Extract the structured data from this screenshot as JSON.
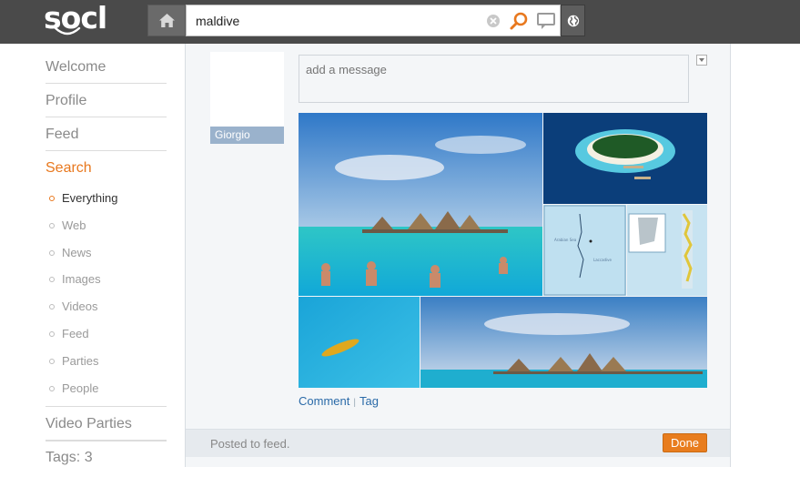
{
  "app": {
    "logo_text": "socl"
  },
  "search": {
    "value": "maldive",
    "placeholder": ""
  },
  "sidebar": {
    "nav": [
      {
        "label": "Welcome"
      },
      {
        "label": "Profile"
      },
      {
        "label": "Feed"
      },
      {
        "label": "Search"
      }
    ],
    "search_sub_items": [
      {
        "label": "Everything",
        "active": true
      },
      {
        "label": "Web"
      },
      {
        "label": "News"
      },
      {
        "label": "Images"
      },
      {
        "label": "Videos"
      },
      {
        "label": "Feed"
      },
      {
        "label": "Parties"
      },
      {
        "label": "People"
      }
    ],
    "video_parties": "Video Parties",
    "tags": "Tags: 3"
  },
  "post": {
    "author": "Giorgio",
    "message_placeholder": "add a message",
    "actions": {
      "comment": "Comment",
      "separator": "|",
      "tag": "Tag"
    },
    "status": "Posted to feed.",
    "done_label": "Done"
  },
  "colors": {
    "accent": "#e8781e",
    "link": "#2a6aa8",
    "topbar": "#4a4a4a"
  },
  "icons": {
    "home": "home-icon",
    "clear": "clear-icon",
    "search": "search-icon",
    "comment": "comment-icon",
    "globe": "globe-icon",
    "dropdown": "chevron-down-icon"
  }
}
